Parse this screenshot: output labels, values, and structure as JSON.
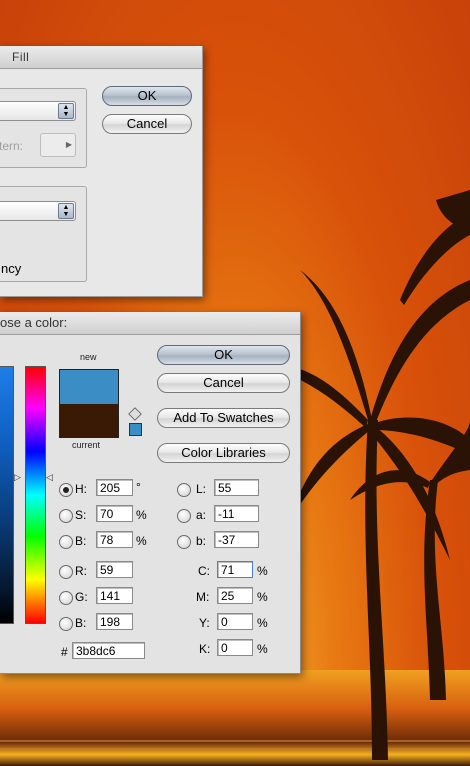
{
  "fill_dialog": {
    "title": "Fill",
    "ok_label": "OK",
    "cancel_label": "Cancel",
    "pattern_label": "tern:",
    "transparency_label": "ncy"
  },
  "color_picker": {
    "title": "ose a color:",
    "new_label": "new",
    "current_label": "current",
    "buttons": {
      "ok": "OK",
      "cancel": "Cancel",
      "add_to_swatches": "Add To Swatches",
      "color_libraries": "Color Libraries"
    },
    "new_color": "#3b8dc6",
    "current_color": "#3a1a05",
    "hsb": {
      "h_label": "H:",
      "h_value": "205",
      "h_unit": "°",
      "s_label": "S:",
      "s_value": "70",
      "s_unit": "%",
      "b_label": "B:",
      "b_value": "78",
      "b_unit": "%"
    },
    "rgb": {
      "r_label": "R:",
      "r_value": "59",
      "g_label": "G:",
      "g_value": "141",
      "b_label": "B:",
      "b_value": "198"
    },
    "lab": {
      "l_label": "L:",
      "l_value": "55",
      "a_label": "a:",
      "a_value": "-11",
      "b_label": "b:",
      "b_value": "-37"
    },
    "cmyk": {
      "c_label": "C:",
      "c_value": "71",
      "c_unit": "%",
      "m_label": "M:",
      "m_value": "25",
      "m_unit": "%",
      "y_label": "Y:",
      "y_value": "0",
      "y_unit": "%",
      "k_label": "K:",
      "k_value": "0",
      "k_unit": "%"
    },
    "hex_label": "#",
    "hex_value": "3b8dc6"
  }
}
